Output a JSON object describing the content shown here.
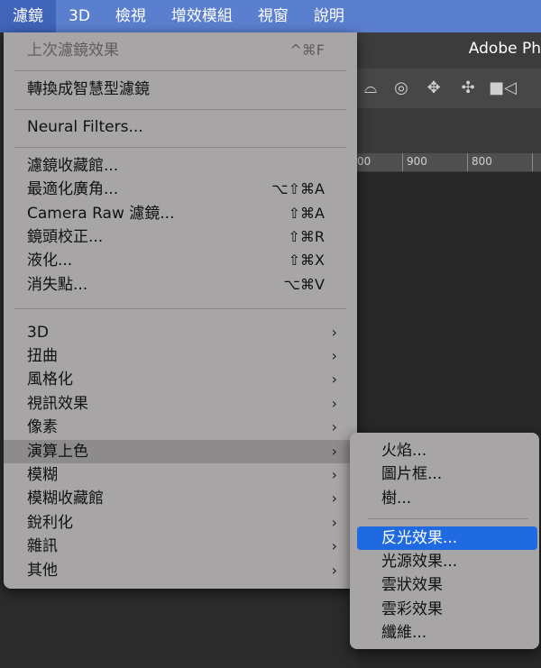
{
  "menubar": {
    "items": [
      "濾鏡",
      "3D",
      "檢視",
      "增效模組",
      "視窗",
      "說明"
    ],
    "active_index": 0
  },
  "app": {
    "title": "Adobe Ph",
    "ruler": [
      "00",
      "900",
      "800"
    ],
    "toolbar_icons": [
      "orbit-icon",
      "rotate-icon",
      "pan-icon",
      "slide-icon",
      "video-camera-icon"
    ]
  },
  "filter_menu": {
    "group1": [
      {
        "label": "上次濾鏡效果",
        "shortcut": "^⌘F",
        "disabled": true
      }
    ],
    "group2": [
      {
        "label": "轉換成智慧型濾鏡"
      }
    ],
    "group3": [
      {
        "label": "Neural Filters..."
      }
    ],
    "group4": [
      {
        "label": "濾鏡收藏館...",
        "shortcut": ""
      },
      {
        "label": "最適化廣角...",
        "shortcut": "⌥⇧⌘A"
      },
      {
        "label": "Camera Raw 濾鏡...",
        "shortcut": "⇧⌘A"
      },
      {
        "label": "鏡頭校正...",
        "shortcut": "⇧⌘R"
      },
      {
        "label": "液化...",
        "shortcut": "⇧⌘X"
      },
      {
        "label": "消失點...",
        "shortcut": "⌥⌘V"
      }
    ],
    "group5": [
      {
        "label": "3D"
      },
      {
        "label": "扭曲"
      },
      {
        "label": "風格化"
      },
      {
        "label": "視訊效果"
      },
      {
        "label": "像素"
      },
      {
        "label": "演算上色"
      },
      {
        "label": "模糊"
      },
      {
        "label": "模糊收藏館"
      },
      {
        "label": "銳利化"
      },
      {
        "label": "雜訊"
      },
      {
        "label": "其他"
      }
    ],
    "highlighted": "演算上色",
    "arrow": "›"
  },
  "render_submenu": {
    "group1": [
      "火焰...",
      "圖片框...",
      "樹..."
    ],
    "group2": [
      "反光效果...",
      "光源效果...",
      "雲狀效果",
      "雲彩效果",
      "纖維..."
    ],
    "selected": "反光效果..."
  }
}
